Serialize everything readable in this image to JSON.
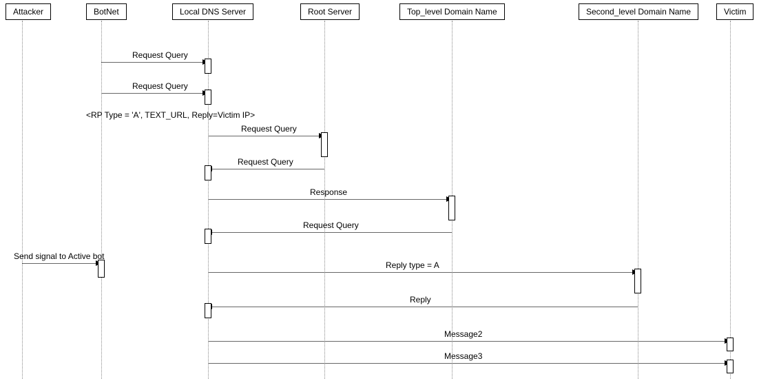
{
  "participants": {
    "attacker": "Attacker",
    "botnet": "BotNet",
    "local_dns": "Local DNS Server",
    "root": "Root Server",
    "tld": "Top_level Domain Name",
    "sld": "Second_level Domain Name",
    "victim": "Victim"
  },
  "messages": {
    "m1": "Request Query",
    "m2": "Request Query",
    "m3": "Request Query",
    "m4": "Request Query",
    "m5": "Response",
    "m6": "Request Query",
    "m7": "Send signal to Active bot",
    "m8": "Reply type = A",
    "m9": "Reply",
    "m10": "Message2",
    "m11": "Message3"
  },
  "notes": {
    "n1": "<RP Type = 'A', TEXT_URL, Reply=Victim IP>"
  },
  "chart_data": {
    "type": "sequence",
    "participants": [
      "Attacker",
      "BotNet",
      "Local DNS Server",
      "Root Server",
      "Top_level Domain Name",
      "Second_level Domain Name",
      "Victim"
    ],
    "interactions": [
      {
        "from": "BotNet",
        "to": "Local DNS Server",
        "label": "Request Query"
      },
      {
        "from": "BotNet",
        "to": "Local DNS Server",
        "label": "Request Query"
      },
      {
        "note": "<RP Type = 'A', TEXT_URL, Reply=Victim IP>"
      },
      {
        "from": "Local DNS Server",
        "to": "Root Server",
        "label": "Request Query"
      },
      {
        "from": "Root Server",
        "to": "Local DNS Server",
        "label": "Request Query"
      },
      {
        "from": "Local DNS Server",
        "to": "Top_level Domain Name",
        "label": "Response"
      },
      {
        "from": "Top_level Domain Name",
        "to": "Local DNS Server",
        "label": "Request Query"
      },
      {
        "from": "Attacker",
        "to": "BotNet",
        "label": "Send signal to Active bot"
      },
      {
        "from": "Local DNS Server",
        "to": "Second_level Domain Name",
        "label": "Reply type = A"
      },
      {
        "from": "Second_level Domain Name",
        "to": "Local DNS Server",
        "label": "Reply"
      },
      {
        "from": "Local DNS Server",
        "to": "Victim",
        "label": "Message2"
      },
      {
        "from": "Local DNS Server",
        "to": "Victim",
        "label": "Message3"
      }
    ]
  }
}
